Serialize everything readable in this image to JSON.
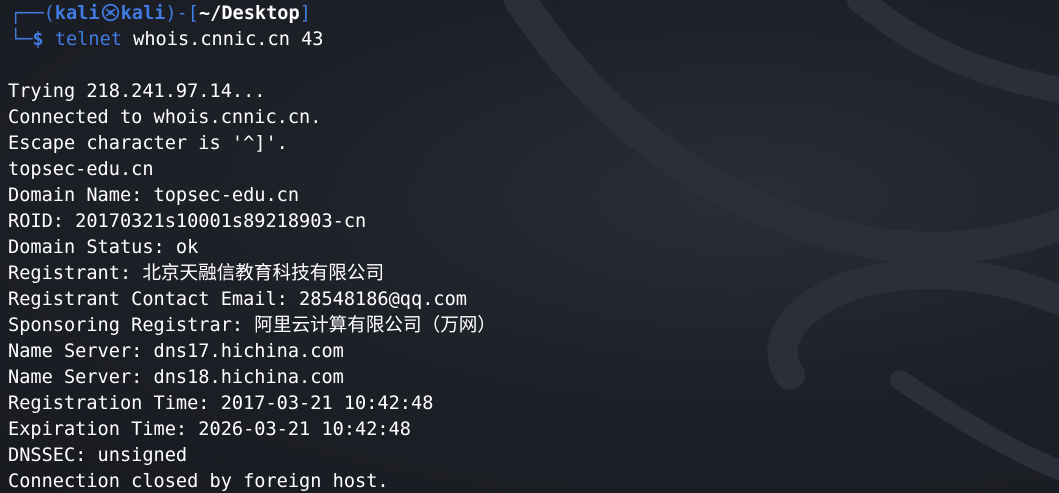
{
  "prompt": {
    "frame_open": "┌──(",
    "user": "kali",
    "host": "kali",
    "frame_mid": ")-[",
    "cwd": "~/Desktop",
    "frame_close": "]",
    "second_prefix": "└─",
    "dollar": "$",
    "command": "telnet",
    "args": "whois.cnnic.cn 43",
    "skull_icon": "kali-skull-icon"
  },
  "output": [
    "Trying 218.241.97.14...",
    "Connected to whois.cnnic.cn.",
    "Escape character is '^]'.",
    "topsec-edu.cn",
    "Domain Name: topsec-edu.cn",
    "ROID: 20170321s10001s89218903-cn",
    "Domain Status: ok",
    "Registrant: 北京天融信教育科技有限公司",
    "Registrant Contact Email: 28548186@qq.com",
    "Sponsoring Registrar: 阿里云计算有限公司（万网）",
    "Name Server: dns17.hichina.com",
    "Name Server: dns18.hichina.com",
    "Registration Time: 2017-03-21 10:42:48",
    "Expiration Time: 2026-03-21 10:42:48",
    "DNSSEC: unsigned",
    "Connection closed by foreign host."
  ],
  "colors": {
    "background": "#1f2129",
    "prompt_blue": "#3f7be0",
    "text": "#ffffff"
  }
}
